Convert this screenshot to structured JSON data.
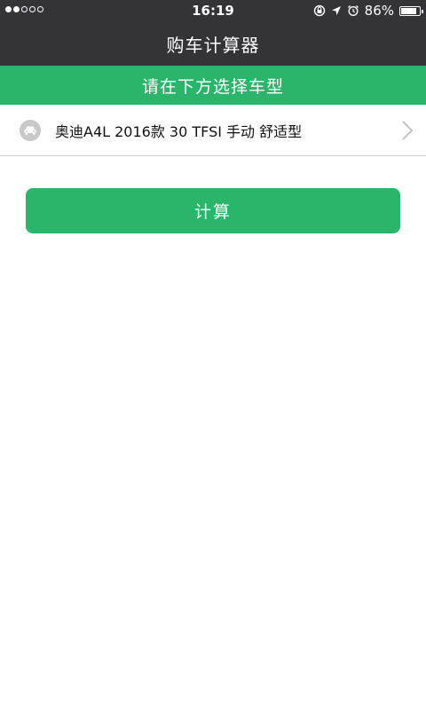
{
  "status_bar": {
    "time": "16:19",
    "battery_percent": "86%",
    "battery_level": 0.86,
    "signal_bars_filled": 2,
    "signal_bars_total": 5,
    "icons": [
      "orientation-lock-icon",
      "location-arrow-icon",
      "alarm-icon",
      "battery-icon"
    ]
  },
  "nav": {
    "title": "购车计算器"
  },
  "banner": {
    "text": "请在下方选择车型"
  },
  "car_selector": {
    "icon": "car-icon",
    "label": "奥迪A4L 2016款 30 TFSI 手动 舒适型",
    "chevron": "chevron-right-icon"
  },
  "actions": {
    "calculate_label": "计算"
  },
  "colors": {
    "header_bg": "#333338",
    "accent_green": "#2bb56a",
    "text_dark": "#111111",
    "divider": "#cccccc"
  }
}
